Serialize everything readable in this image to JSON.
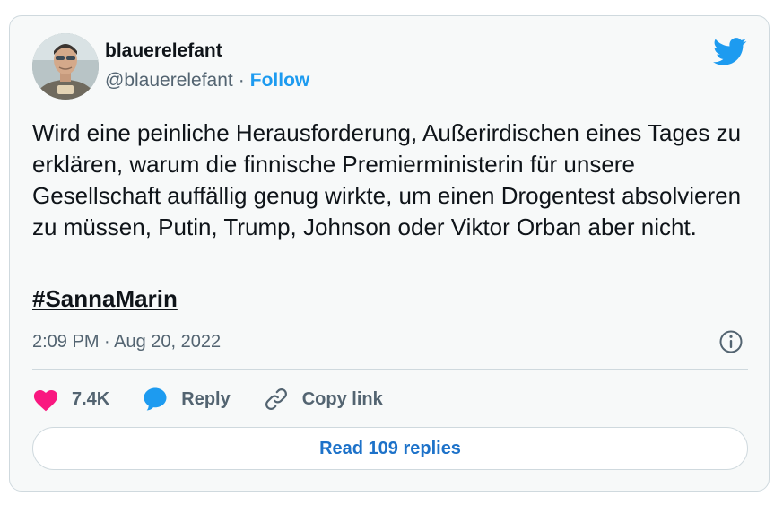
{
  "tweet": {
    "author": {
      "display_name": "blauerelefant",
      "handle": "@blauerelefant",
      "separator": "·",
      "follow_label": "Follow"
    },
    "text": "Wird eine peinliche Herausforderung, Außerirdischen eines Tages zu erklären, warum die finnische Premierministerin für unsere Gesellschaft auffällig genug wirkte, um einen Drogentest absolvieren zu müssen, Putin, Trump, Johnson oder Viktor Orban aber nicht.",
    "hashtag": "#SannaMarin",
    "timestamp": "2:09 PM · Aug 20, 2022",
    "likes_count": "7.4K",
    "reply_label": "Reply",
    "copy_link_label": "Copy link",
    "read_replies_label": "Read 109 replies"
  },
  "icons": {
    "brand": "twitter-bird-icon",
    "info": "info-icon",
    "like": "heart-icon",
    "reply": "speech-bubble-icon",
    "copy_link": "link-icon"
  },
  "colors": {
    "accent": "#1d9bf0",
    "like": "#f91880",
    "text": "#0f1419",
    "muted": "#536471",
    "border": "#cfd9de",
    "card_background": "#f7f9f9"
  }
}
